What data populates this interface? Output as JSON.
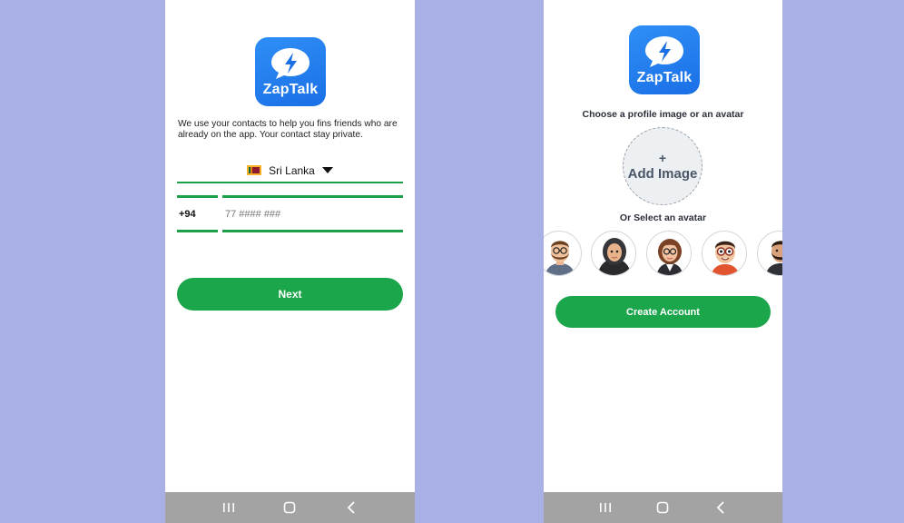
{
  "app": {
    "name": "ZapTalk",
    "logo_icon": "lightning-chat-bubble-icon"
  },
  "screen1": {
    "intro": "We use your contacts to help you fins friends who are already on the app. Your contact stay private.",
    "country": {
      "flag": "sri-lanka-flag-icon",
      "name": "Sri Lanka",
      "dropdown_icon": "caret-down-icon"
    },
    "country_code": "+94",
    "phone_placeholder": "77 #### ###",
    "next_label": "Next"
  },
  "screen2": {
    "choose_label": "Choose a profile image or an avatar",
    "add_image_plus": "+",
    "add_image_label": "Add Image",
    "or_label": "Or Select an avatar",
    "avatars": [
      "avatar-bearded-man-glasses",
      "avatar-woman-hijab",
      "avatar-woman-glasses",
      "avatar-boy-glasses",
      "avatar-man-beard"
    ],
    "create_label": "Create Account"
  },
  "navbar": {
    "recents": "recents-icon",
    "home": "home-icon",
    "back": "back-icon"
  },
  "colors": {
    "background": "#a9b0e6",
    "brand_blue": "#1a6fe6",
    "accent_green": "#1ba64c",
    "navbar": "#a3a3a3"
  }
}
